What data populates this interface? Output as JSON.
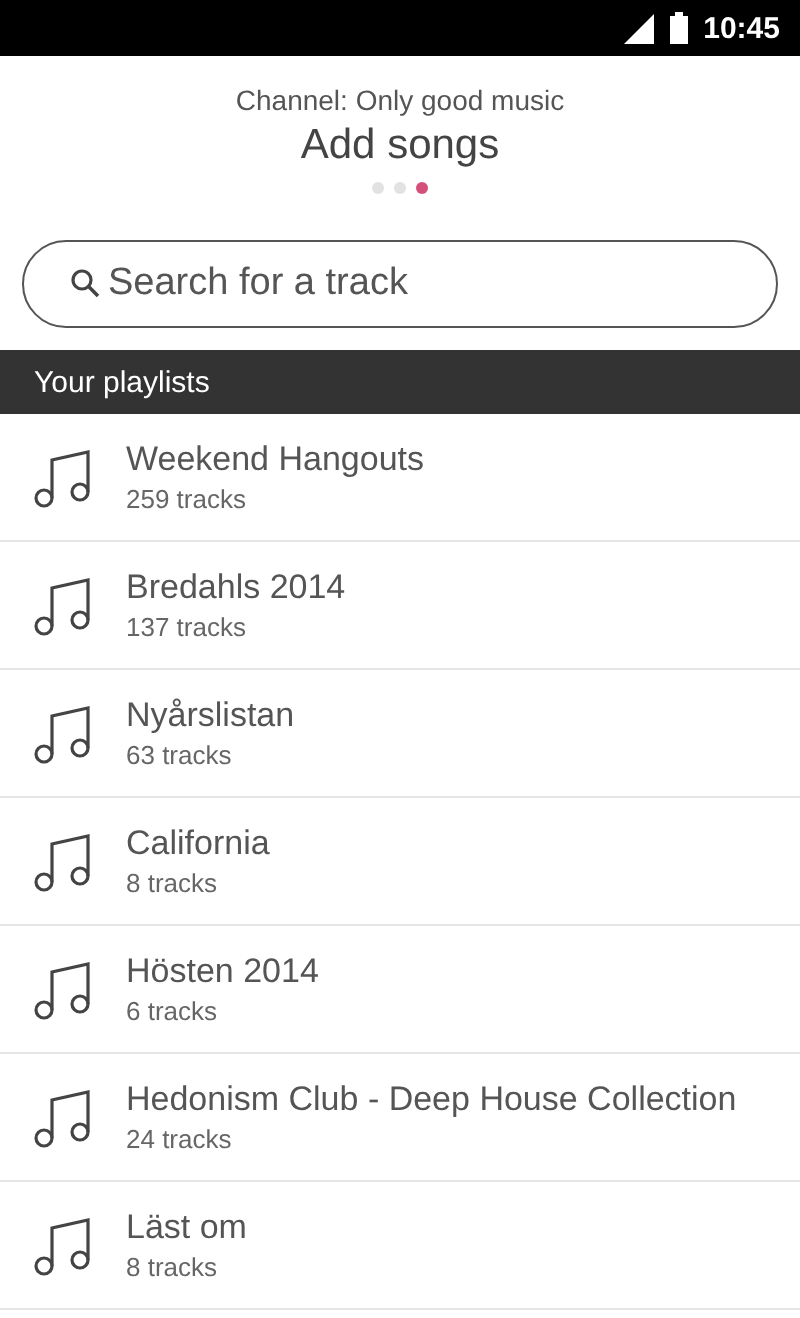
{
  "status_bar": {
    "time": "10:45"
  },
  "header": {
    "subtitle": "Channel: Only good music",
    "title": "Add songs",
    "pager": [
      {
        "selected": false
      },
      {
        "selected": false
      },
      {
        "selected": true
      }
    ]
  },
  "search": {
    "placeholder": "Search for a track"
  },
  "section": {
    "title": "Your playlists"
  },
  "playlists": [
    {
      "name": "Weekend Hangouts",
      "count": "259 tracks"
    },
    {
      "name": "Bredahls 2014",
      "count": "137 tracks"
    },
    {
      "name": "Nyårslistan",
      "count": "63 tracks"
    },
    {
      "name": "California",
      "count": "8 tracks"
    },
    {
      "name": "Hösten 2014",
      "count": "6 tracks"
    },
    {
      "name": "Hedonism Club - Deep House Collection",
      "count": "24 tracks"
    },
    {
      "name": "Läst om",
      "count": "8 tracks"
    }
  ]
}
